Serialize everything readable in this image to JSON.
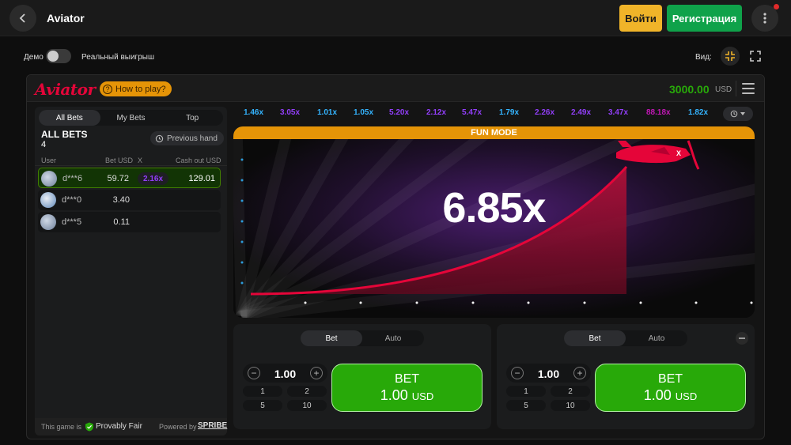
{
  "topbar": {
    "title": "Aviator",
    "login_label": "Войти",
    "register_label": "Регистрация"
  },
  "mode": {
    "demo_label": "Демо",
    "real_label": "Реальный выигрыш",
    "view_label": "Вид:"
  },
  "game": {
    "logo": "Aviator",
    "how_to_play": "How to play?",
    "balance": "3000.00",
    "currency": "USD"
  },
  "bets_panel": {
    "tabs": [
      "All Bets",
      "My Bets",
      "Top"
    ],
    "title": "ALL BETS",
    "count": "4",
    "previous_hand": "Previous hand",
    "columns": {
      "user": "User",
      "bet": "Bet USD",
      "x": "X",
      "cashout": "Cash out USD"
    },
    "rows": [
      {
        "user": "d***6",
        "bet": "59.72",
        "mult": "2.16x",
        "cashout": "129.01"
      },
      {
        "user": "d***0",
        "bet": "3.40",
        "mult": "",
        "cashout": ""
      },
      {
        "user": "d***5",
        "bet": "0.11",
        "mult": "",
        "cashout": ""
      }
    ],
    "footer": {
      "game_is": "This game is",
      "provably_fair": "Provably Fair",
      "powered_by": "Powered by",
      "brand": "SPRIBE"
    }
  },
  "multipliers": [
    {
      "v": "1.46x",
      "color": "#34b4ff"
    },
    {
      "v": "3.05x",
      "color": "#913ef8"
    },
    {
      "v": "1.01x",
      "color": "#34b4ff"
    },
    {
      "v": "1.05x",
      "color": "#34b4ff"
    },
    {
      "v": "5.20x",
      "color": "#913ef8"
    },
    {
      "v": "2.12x",
      "color": "#913ef8"
    },
    {
      "v": "5.47x",
      "color": "#913ef8"
    },
    {
      "v": "1.79x",
      "color": "#34b4ff"
    },
    {
      "v": "2.26x",
      "color": "#913ef8"
    },
    {
      "v": "2.49x",
      "color": "#913ef8"
    },
    {
      "v": "3.47x",
      "color": "#913ef8"
    },
    {
      "v": "88.18x",
      "color": "#c017b4"
    },
    {
      "v": "1.82x",
      "color": "#34b4ff"
    }
  ],
  "canvas": {
    "fun_mode": "FUN MODE",
    "multiplier": "6.85x"
  },
  "bet_panels": [
    {
      "tabs": [
        "Bet",
        "Auto"
      ],
      "amount": "1.00",
      "quick": [
        "1",
        "2",
        "5",
        "10"
      ],
      "button_label": "BET",
      "button_amount": "1.00",
      "button_currency": "USD"
    },
    {
      "tabs": [
        "Bet",
        "Auto"
      ],
      "amount": "1.00",
      "quick": [
        "1",
        "2",
        "5",
        "10"
      ],
      "button_label": "BET",
      "button_amount": "1.00",
      "button_currency": "USD"
    }
  ],
  "colors": {
    "accent_red": "#e50539",
    "green": "#28a909",
    "yellow": "#f0b429",
    "fun_bar": "#e59407"
  }
}
